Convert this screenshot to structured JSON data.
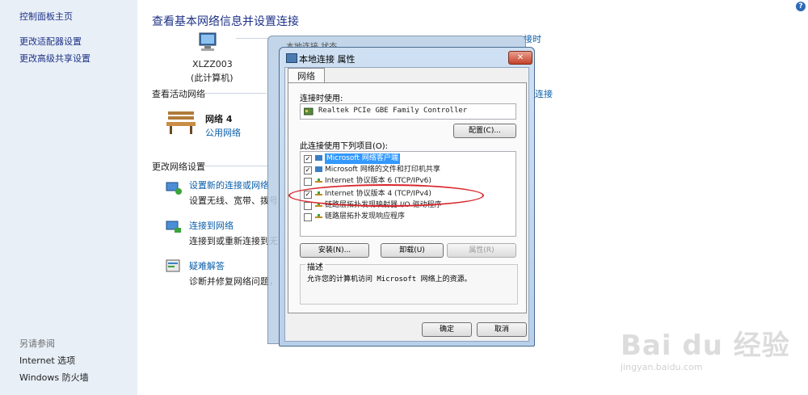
{
  "sidebar": {
    "home": "控制面板主页",
    "links": [
      "更改适配器设置",
      "更改高级共享设置"
    ],
    "see_also_heading": "另请参阅",
    "see_also": [
      "Internet 选项",
      "Windows 防火墙"
    ]
  },
  "main": {
    "title": "查看基本网络信息并设置连接",
    "computer_name": "XLZZ003",
    "computer_sub": "(此计算机)",
    "active_heading": "查看活动网络",
    "network_name": "网络 4",
    "network_type": "公用网络",
    "right_link_1": "接时",
    "right_link_2": "连接",
    "change_heading": "更改网络设置",
    "tasks": [
      {
        "title": "设置新的连接或网络",
        "desc": "设置无线、宽带、拨号"
      },
      {
        "title": "连接到网络",
        "desc": "连接到或重新连接到无"
      },
      {
        "title": "疑难解答",
        "desc": "诊断并修复网络问题，"
      }
    ]
  },
  "back_window": {
    "title": "本地连接 状态"
  },
  "dialog": {
    "title": "本地连接 属性",
    "close": "✕",
    "tab": "网络",
    "connect_using_label": "连接时使用:",
    "adapter": "Realtek PCIe GBE Family Controller",
    "configure": "配置(C)...",
    "items_label": "此连接使用下列项目(O):",
    "items": [
      {
        "label": "Microsoft 网络客户端",
        "checked": true,
        "selected": true
      },
      {
        "label": "Microsoft 网络的文件和打印机共享",
        "checked": true,
        "selected": false
      },
      {
        "label": "Internet 协议版本 6 (TCP/IPv6)",
        "checked": false,
        "selected": false
      },
      {
        "label": "Internet 协议版本 4 (TCP/IPv4)",
        "checked": true,
        "selected": false
      },
      {
        "label": "链路层拓扑发现映射器 I/O 驱动程序",
        "checked": false,
        "selected": false
      },
      {
        "label": "链路层拓扑发现响应程序",
        "checked": false,
        "selected": false
      }
    ],
    "install": "安装(N)...",
    "uninstall": "卸载(U)",
    "properties": "属性(R)",
    "desc_label": "描述",
    "desc_text": "允许您的计算机访问 Microsoft 网络上的资源。",
    "ok": "确定",
    "cancel": "取消"
  },
  "watermark": {
    "brand": "Bai du 经验",
    "url": "jingyan.baidu.com"
  }
}
